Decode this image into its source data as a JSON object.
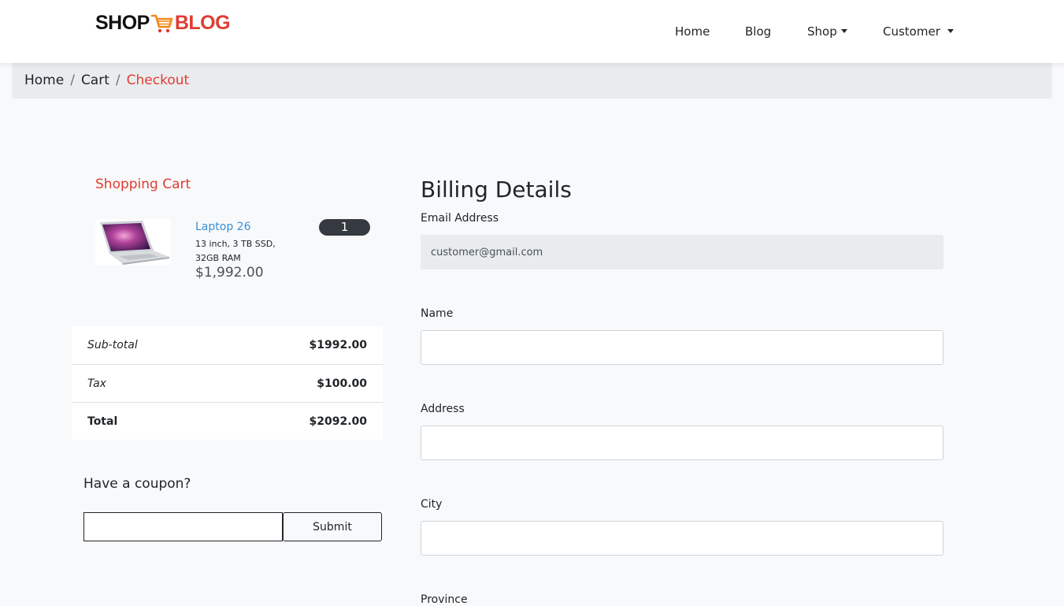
{
  "brand": {
    "part1": "SHOP",
    "part2": "BLOG"
  },
  "nav": {
    "home": "Home",
    "blog": "Blog",
    "shop": "Shop",
    "customer": "Customer"
  },
  "breadcrumb": {
    "items": [
      "Home",
      "Cart"
    ],
    "active": "Checkout",
    "separator": "/"
  },
  "cart": {
    "title": "Shopping Cart",
    "items": [
      {
        "name": "Laptop 26",
        "description": "13 inch, 3 TB SSD, 32GB RAM",
        "price": "$1,992.00",
        "quantity": "1"
      }
    ]
  },
  "totals": {
    "subtotal_label": "Sub-total",
    "subtotal_value": "$1992.00",
    "tax_label": "Tax",
    "tax_value": "$100.00",
    "total_label": "Total",
    "total_value": "$2092.00"
  },
  "coupon": {
    "title": "Have a coupon?",
    "value": "",
    "submit_label": "Submit"
  },
  "billing": {
    "title": "Billing Details",
    "email_label": "Email Address",
    "email_value": "customer@gmail.com",
    "name_label": "Name",
    "name_value": "",
    "address_label": "Address",
    "address_value": "",
    "city_label": "City",
    "city_value": "",
    "province_label": "Province"
  },
  "colors": {
    "accent": "#e03c31",
    "link": "#3a8fd6",
    "badge": "#343a40",
    "page_bg": "#f8f9fa",
    "breadcrumb_bg": "#e9ecef"
  }
}
